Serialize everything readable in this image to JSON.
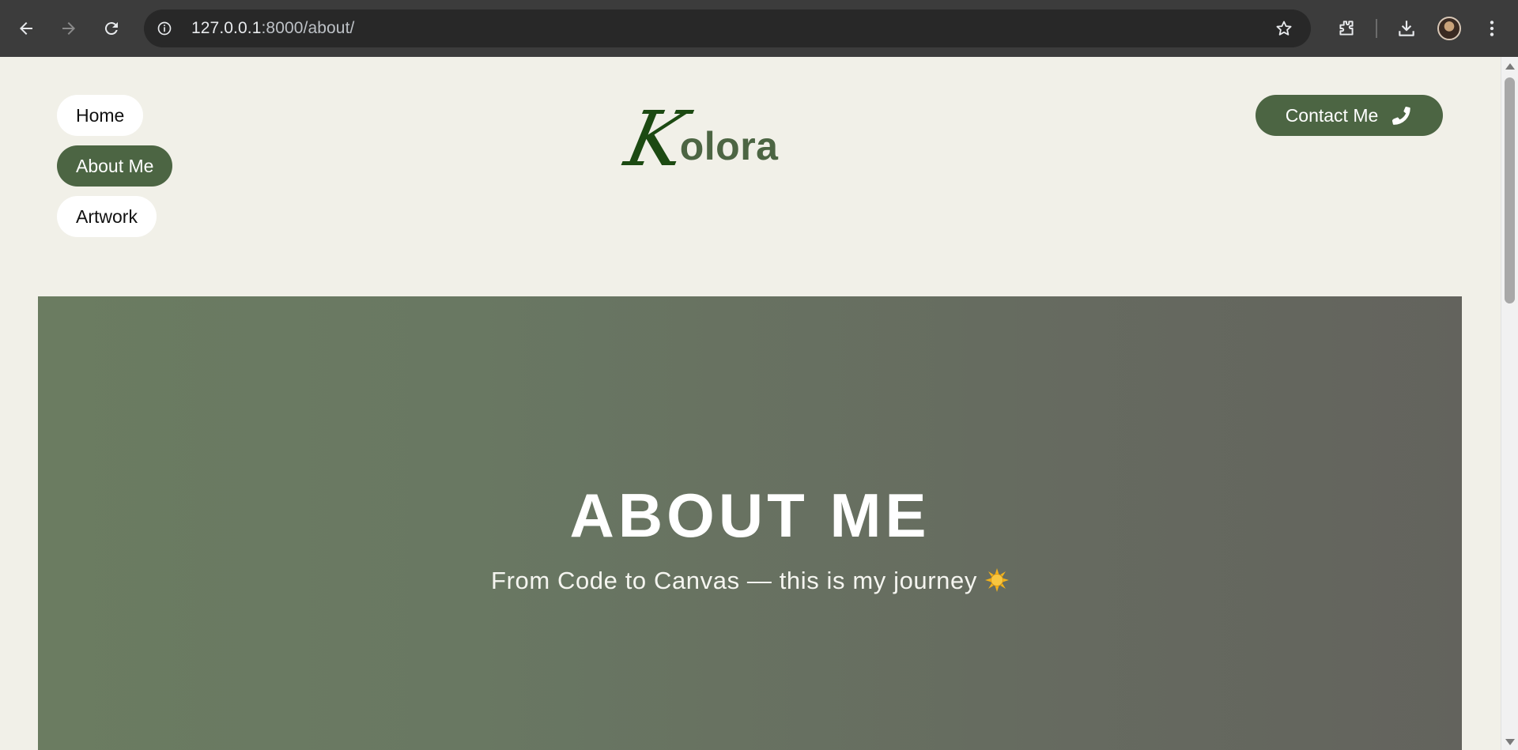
{
  "browser": {
    "url_host": "127.0.0.1",
    "url_path": ":8000/about/"
  },
  "nav": {
    "items": [
      {
        "label": "Home",
        "active": false
      },
      {
        "label": "About Me",
        "active": true
      },
      {
        "label": "Artwork",
        "active": false
      }
    ]
  },
  "logo": {
    "initial": "K",
    "rest": "olora"
  },
  "contact": {
    "label": "Contact Me"
  },
  "hero": {
    "title": "ABOUT ME",
    "subtitle": "From Code to Canvas — this is my journey"
  },
  "colors": {
    "accent": "#4c6543",
    "logo_k": "#1c4a12",
    "page_bg": "#f1f0e8"
  }
}
